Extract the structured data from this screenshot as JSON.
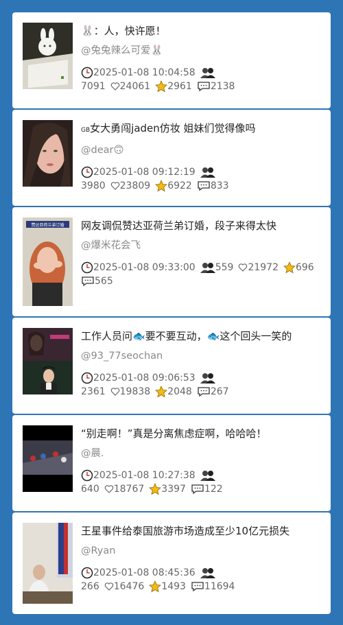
{
  "posts": [
    {
      "title": "🐰：人，快许愿！",
      "author": "@兔兔辣么可爱🐰",
      "time": "2025-01-08 10:04:58",
      "views": "",
      "plays": "7091",
      "likes": "24061",
      "favorites": "2961",
      "comments": "2138"
    },
    {
      "title_prefix": "GB",
      "title": "女大勇闯jaden仿妆 姐妹们觉得像吗",
      "author": "@dear🙃",
      "time": "2025-01-08 09:12:19",
      "views": "",
      "plays": "3980",
      "likes": "23809",
      "favorites": "6922",
      "comments": "833"
    },
    {
      "title": "网友调侃赞达亚荷兰弟订婚，段子来得太快",
      "author": "@爆米花会飞",
      "time": "2025-01-08 09:33:00",
      "views": "559",
      "plays": "",
      "likes": "21972",
      "favorites": "696",
      "comments": "565",
      "thumb_caption": "赞达亚荷兰弟订婚"
    },
    {
      "title": "工作人员问🐟要不要互动，🐟这个回头一笑的",
      "author": "@93_77seochan",
      "time": "2025-01-08 09:06:53",
      "views": "",
      "plays": "2361",
      "likes": "19838",
      "favorites": "2048",
      "comments": "267"
    },
    {
      "title": "“别走啊！”真是分离焦虑症啊，哈哈哈！",
      "author": "@晨.",
      "time": "2025-01-08 10:27:38",
      "views": "",
      "plays": "640",
      "likes": "18767",
      "favorites": "3397",
      "comments": "122"
    },
    {
      "title": "王星事件给泰国旅游市场造成至少10亿元损失",
      "author": "@Ryan",
      "time": "2025-01-08 08:45:36",
      "views": "",
      "plays": "266",
      "likes": "16476",
      "favorites": "1493",
      "comments": "11694"
    }
  ],
  "icons": {
    "clock": "clock-icon",
    "users": "users-icon",
    "heart": "heart-icon",
    "star": "star-icon",
    "comment": "comment-icon"
  },
  "colors": {
    "background": "#2e75b6",
    "star": "#f5b915",
    "card": "#ffffff"
  }
}
